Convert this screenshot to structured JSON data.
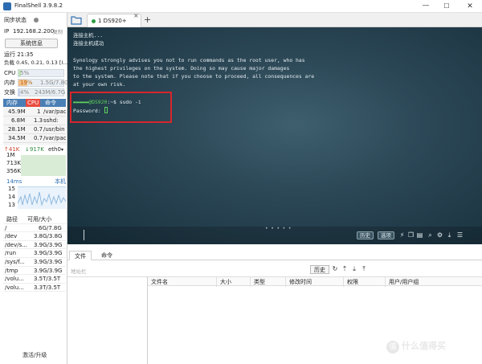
{
  "window": {
    "title": "FinalShell 3.9.8.2",
    "minimize": "—",
    "maximize": "☐",
    "close": "✕"
  },
  "sidebar": {
    "sync_status": "同步状态",
    "ip_label": "IP",
    "ip_value": "192.168.2.200",
    "copy_label": "复制",
    "sysinfo_button": "系统信息",
    "uptime": "运行 21:35",
    "load": "负载 0.45, 0.21, 0.13 [I...",
    "cpu": {
      "label": "CPU",
      "value": "5%",
      "percent": 5
    },
    "memory": {
      "label": "内存",
      "percent_text": "19%",
      "value": "1.5G/7.8G",
      "percent": 19
    },
    "swap": {
      "label": "交换",
      "percent_text": "4%",
      "value": "243M/6.7G",
      "percent": 4
    },
    "proc_tabs": [
      "内存",
      "CPU",
      "命令"
    ],
    "processes": [
      {
        "mem": "45.9M",
        "cpu": "1",
        "cmd": "/var/pac"
      },
      {
        "mem": "6.8M",
        "cpu": "1.3",
        "cmd": "sshd:"
      },
      {
        "mem": "28.1M",
        "cpu": "0.7",
        "cmd": "/usr/bin"
      },
      {
        "mem": "34.5M",
        "cpu": "0.7",
        "cmd": "/var/pac"
      }
    ],
    "net": {
      "up": "↑41K",
      "down": "↓917K",
      "iface": "eth0",
      "scale": [
        "1M",
        "713K",
        "356K"
      ]
    },
    "latency": {
      "value": "14ms",
      "target": "本机",
      "scale": [
        "15",
        "14",
        "13"
      ]
    },
    "disk_headers": [
      "路径",
      "可用/大小"
    ],
    "disks": [
      {
        "path": "/",
        "size": "6G/7.8G"
      },
      {
        "path": "/dev",
        "size": "3.8G/3.8G"
      },
      {
        "path": "/dev/s...",
        "size": "3.9G/3.9G"
      },
      {
        "path": "/run",
        "size": "3.9G/3.9G"
      },
      {
        "path": "/sys/f...",
        "size": "3.9G/3.9G"
      },
      {
        "path": "/tmp",
        "size": "3.9G/3.9G"
      },
      {
        "path": "/volu...",
        "size": "3.5T/3.5T"
      },
      {
        "path": "/volu...",
        "size": "3.3T/3.5T"
      }
    ],
    "activate": "激活/升级"
  },
  "tabs": {
    "session_label": "1  DS920+",
    "close": "×",
    "add": "+"
  },
  "terminal": {
    "lines": [
      "连接主机...",
      "连接主机成功",
      "Synology strongly advises you not to run commands as the root user, who has",
      "the highest privileges on the system. Doing so may cause major damages",
      "to the system. Please note that if you choose to proceed, all consequences are",
      "at your own risk."
    ],
    "prompt_host": "@DS920",
    "prompt_rest": ":~$ sudo -i",
    "password_label": "Password:"
  },
  "command_bar": {
    "history": "历史",
    "options": "选项"
  },
  "bottom": {
    "tabs": [
      "文件",
      "命令"
    ],
    "path_placeholder": "地址栏",
    "history_button": "历史",
    "columns": [
      "文件名",
      "大小",
      "类型",
      "修改时间",
      "权限",
      "用户/用户组"
    ]
  },
  "watermark": {
    "badge": "值",
    "text": "什么值得买"
  }
}
